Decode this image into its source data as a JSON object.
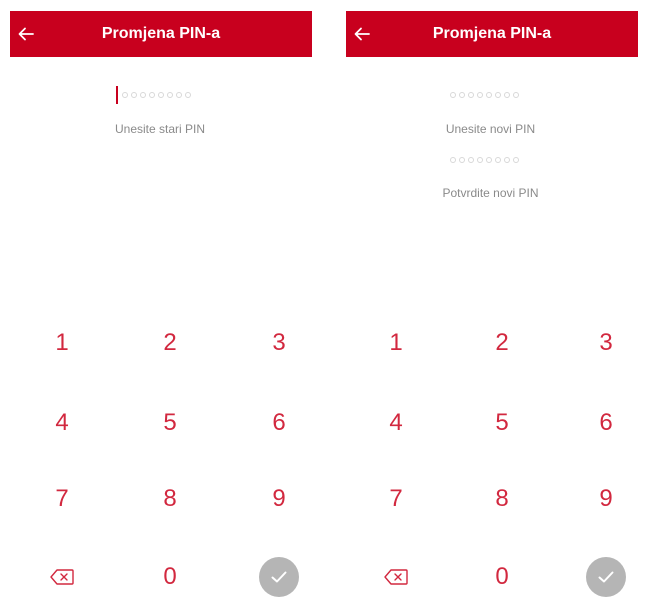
{
  "colors": {
    "brand_red": "#c8001e",
    "key_red": "#d2283f",
    "label_gray": "#8a8a8a",
    "disabled_gray": "#b5b5b5"
  },
  "screens": [
    {
      "header": {
        "back_icon": "arrow-left-icon",
        "title": "Promjena PIN-a"
      },
      "fields": [
        {
          "label": "Unesite stari PIN",
          "length": 8,
          "focused": true
        }
      ],
      "keypad": {
        "keys": [
          "1",
          "2",
          "3",
          "4",
          "5",
          "6",
          "7",
          "8",
          "9",
          "0"
        ],
        "delete_icon": "backspace-icon",
        "confirm_icon": "check-icon",
        "confirm_enabled": false
      }
    },
    {
      "header": {
        "back_icon": "arrow-left-icon",
        "title": "Promjena PIN-a"
      },
      "fields": [
        {
          "label": "Unesite novi PIN",
          "length": 8,
          "focused": false
        },
        {
          "label": "Potvrdite novi PIN",
          "length": 8,
          "focused": false
        }
      ],
      "keypad": {
        "keys": [
          "1",
          "2",
          "3",
          "4",
          "5",
          "6",
          "7",
          "8",
          "9",
          "0"
        ],
        "delete_icon": "backspace-icon",
        "confirm_icon": "check-icon",
        "confirm_enabled": false
      }
    }
  ]
}
